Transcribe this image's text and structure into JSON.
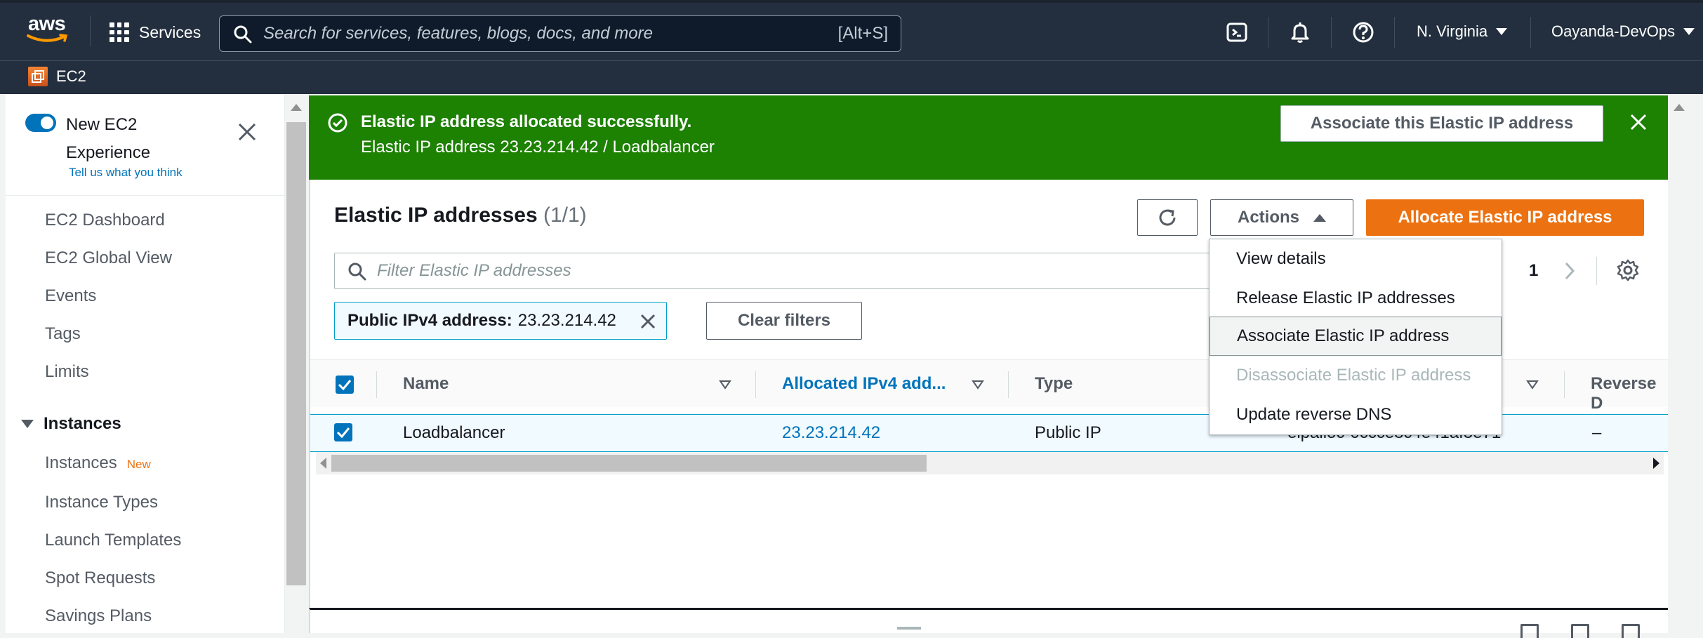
{
  "topnav": {
    "logo_text": "aws",
    "services_label": "Services",
    "search_placeholder": "Search for services, features, blogs, docs, and more",
    "search_shortcut": "[Alt+S]",
    "region": "N. Virginia",
    "account": "Oayanda-DevOps",
    "icons": [
      "cloudshell-icon",
      "bell-icon",
      "help-icon"
    ]
  },
  "subnav": {
    "service": "EC2"
  },
  "sidebar": {
    "experience_title": "New EC2 Experience",
    "experience_link": "Tell us what you think",
    "items": [
      {
        "label": "EC2 Dashboard"
      },
      {
        "label": "EC2 Global View"
      },
      {
        "label": "Events"
      },
      {
        "label": "Tags"
      },
      {
        "label": "Limits"
      }
    ],
    "section_instances": "Instances",
    "instances_items": [
      {
        "label": "Instances",
        "badge": "New"
      },
      {
        "label": "Instance Types"
      },
      {
        "label": "Launch Templates"
      },
      {
        "label": "Spot Requests"
      },
      {
        "label": "Savings Plans"
      }
    ]
  },
  "flash": {
    "title": "Elastic IP address allocated successfully.",
    "message": "Elastic IP address 23.23.214.42 / Loadbalancer",
    "action_label": "Associate this Elastic IP address",
    "color": "#1d8102"
  },
  "panel": {
    "title": "Elastic IP addresses",
    "count": "(1/1)",
    "actions_label": "Actions",
    "allocate_label": "Allocate Elastic IP address",
    "filter_placeholder": "Filter Elastic IP addresses",
    "page_number": "1",
    "token_key": "Public IPv4 address:",
    "token_value": "23.23.214.42",
    "clear_filters_label": "Clear filters",
    "accent_color": "#ec7211"
  },
  "table": {
    "columns": [
      "Name",
      "Allocated IPv4 add...",
      "Type",
      "Reverse D"
    ],
    "rows": [
      {
        "name": "Loadbalancer",
        "ipv4": "23.23.214.42",
        "type": "Public IP",
        "allocation_id": "eipalloc-0ccce8c4e41af5e71",
        "reverse_dns": "–"
      }
    ]
  },
  "actions_menu": {
    "items": [
      {
        "label": "View details",
        "state": "normal"
      },
      {
        "label": "Release Elastic IP addresses",
        "state": "normal"
      },
      {
        "label": "Associate Elastic IP address",
        "state": "hover"
      },
      {
        "label": "Disassociate Elastic IP address",
        "state": "disabled"
      },
      {
        "label": "Update reverse DNS",
        "state": "normal"
      }
    ]
  }
}
